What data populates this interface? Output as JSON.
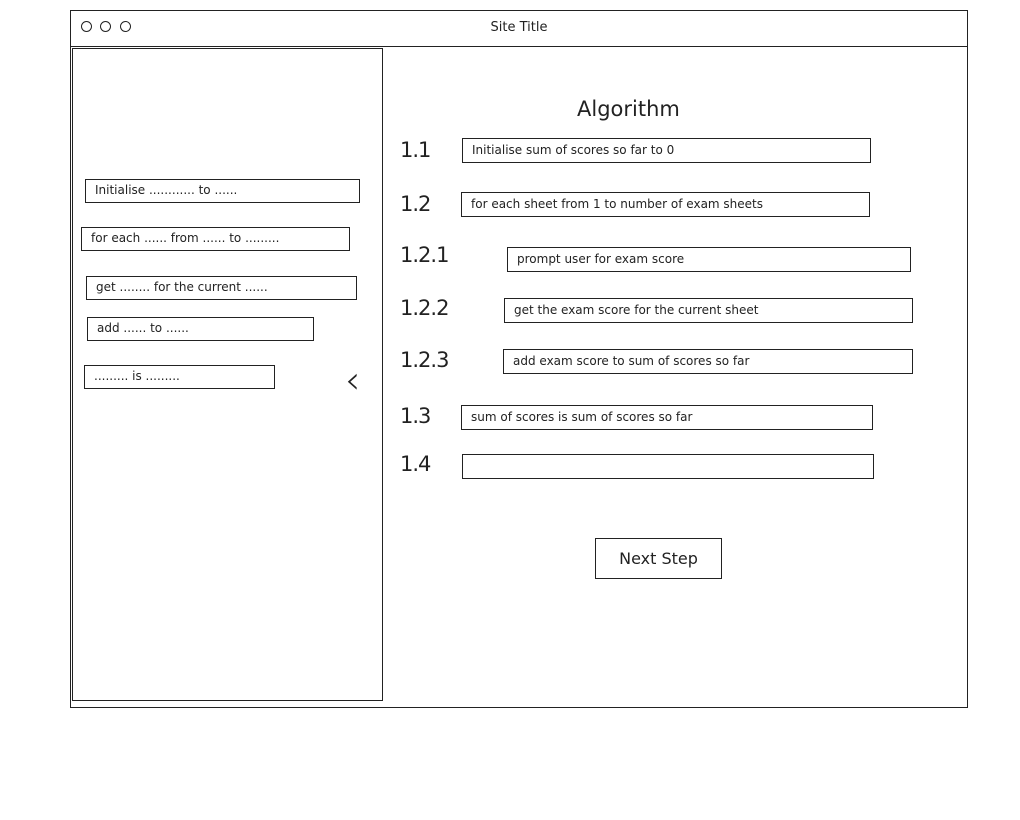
{
  "window": {
    "title": "Site Title",
    "controls": [
      "circle-icon",
      "circle-icon",
      "circle-icon"
    ]
  },
  "sidebar": {
    "templates": [
      {
        "label": "Initialise ............  to ......"
      },
      {
        "label": "for each ...... from ...... to ........."
      },
      {
        "label": "get ........ for the current ......"
      },
      {
        "label": "add ...... to ......"
      },
      {
        "label": "......... is ........."
      }
    ],
    "collapse_icon": "chevron-left-icon"
  },
  "main": {
    "heading": "Algorithm",
    "steps": [
      {
        "number": "1.1",
        "text": "Initialise sum of scores so far to 0"
      },
      {
        "number": "1.2",
        "text": "for each sheet from 1 to number of exam sheets"
      },
      {
        "number": "1.2.1",
        "text": "prompt user for exam score"
      },
      {
        "number": "1.2.2",
        "text": "get the exam score for the current sheet"
      },
      {
        "number": "1.2.3",
        "text": "add exam score to sum of scores so far"
      },
      {
        "number": "1.3",
        "text": "sum of scores is sum of scores so far"
      },
      {
        "number": "1.4",
        "text": ""
      }
    ],
    "next_button": "Next Step"
  }
}
